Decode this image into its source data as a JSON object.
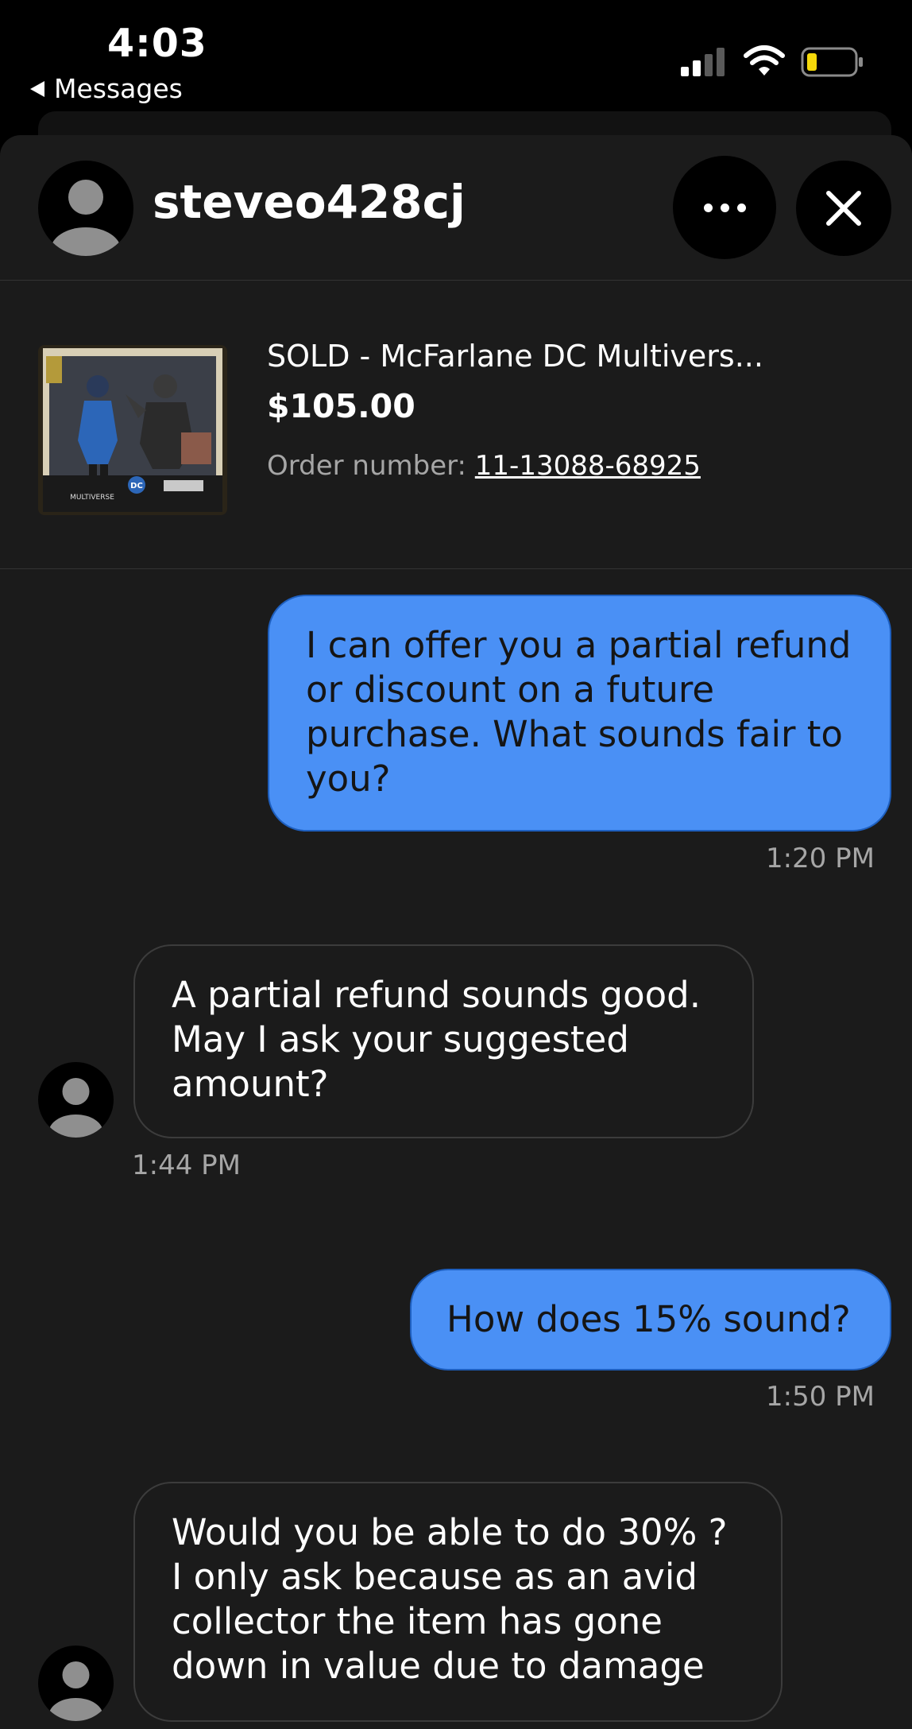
{
  "status_bar": {
    "time": "4:03",
    "back_label": "Messages"
  },
  "header": {
    "username": "steveo428cj"
  },
  "item": {
    "title": "SOLD - McFarlane DC Multivers...",
    "price": "$105.00",
    "order_label": "Order number: ",
    "order_number": "11-13088-68925",
    "image_badge": "DC",
    "image_text": "MULTIVERSE"
  },
  "messages": [
    {
      "direction": "outgoing",
      "text": "I can offer you a partial refund or discount on a future purchase. What sounds fair to you?",
      "time": "1:20 PM"
    },
    {
      "direction": "incoming",
      "text": "A partial refund sounds good. May I ask your suggested amount?",
      "time": "1:44 PM"
    },
    {
      "direction": "outgoing",
      "text": "How does 15% sound?",
      "time": "1:50 PM"
    },
    {
      "direction": "incoming",
      "text": "Would you be able to do 30% ? I only ask because as an avid collector the item has gone down in value due to damage",
      "time": ""
    }
  ],
  "colors": {
    "outgoing_bubble": "#4a90f5",
    "background": "#1b1b1b",
    "battery": "#f5d90a"
  }
}
